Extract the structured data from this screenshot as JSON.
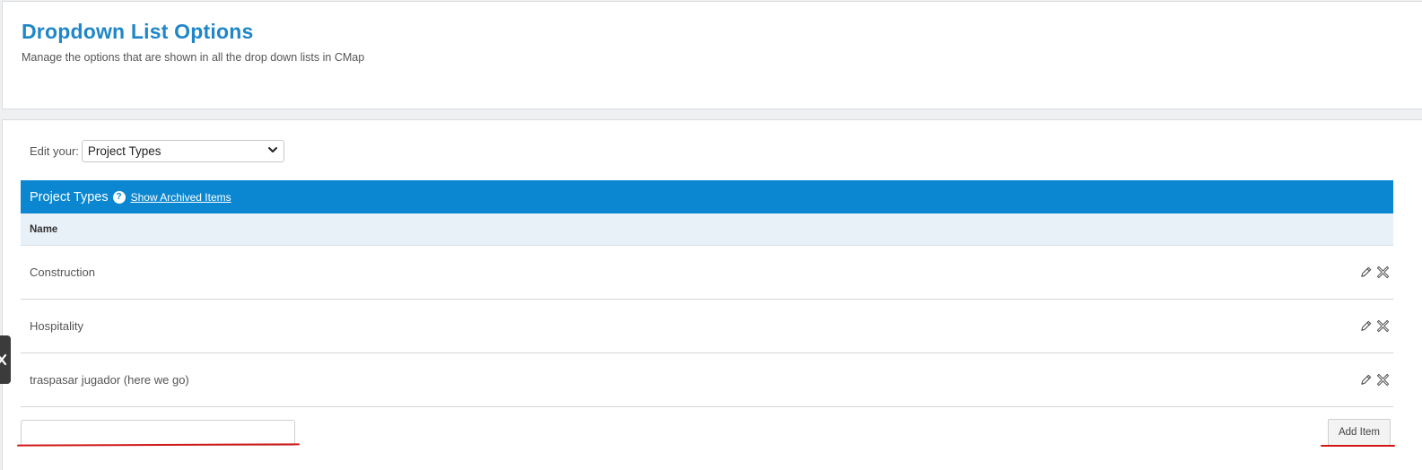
{
  "header": {
    "title": "Dropdown List Options",
    "subtitle": "Manage the options that are shown in all the drop down lists in CMap"
  },
  "editor": {
    "label": "Edit your:",
    "selected_list": "Project Types"
  },
  "list": {
    "title": "Project Types",
    "help_icon_text": "?",
    "archived_link": "Show Archived Items",
    "column_name": "Name",
    "items": [
      {
        "name": "Construction"
      },
      {
        "name": "Hospitality"
      },
      {
        "name": "traspasar jugador (here we go)"
      }
    ]
  },
  "footer": {
    "new_item_value": "",
    "add_button_label": "Add Item"
  },
  "icons": {
    "edit": "pencil-icon",
    "delete": "archive-x-icon",
    "help": "help-circle-icon",
    "select": "chevron-down-icon",
    "side_tab": "close-x-icon"
  },
  "colors": {
    "title": "#1f86c8",
    "list_header_bg": "#0a87d0",
    "column_header_bg": "#e8f0f8",
    "annotation_underline": "#d01818"
  }
}
